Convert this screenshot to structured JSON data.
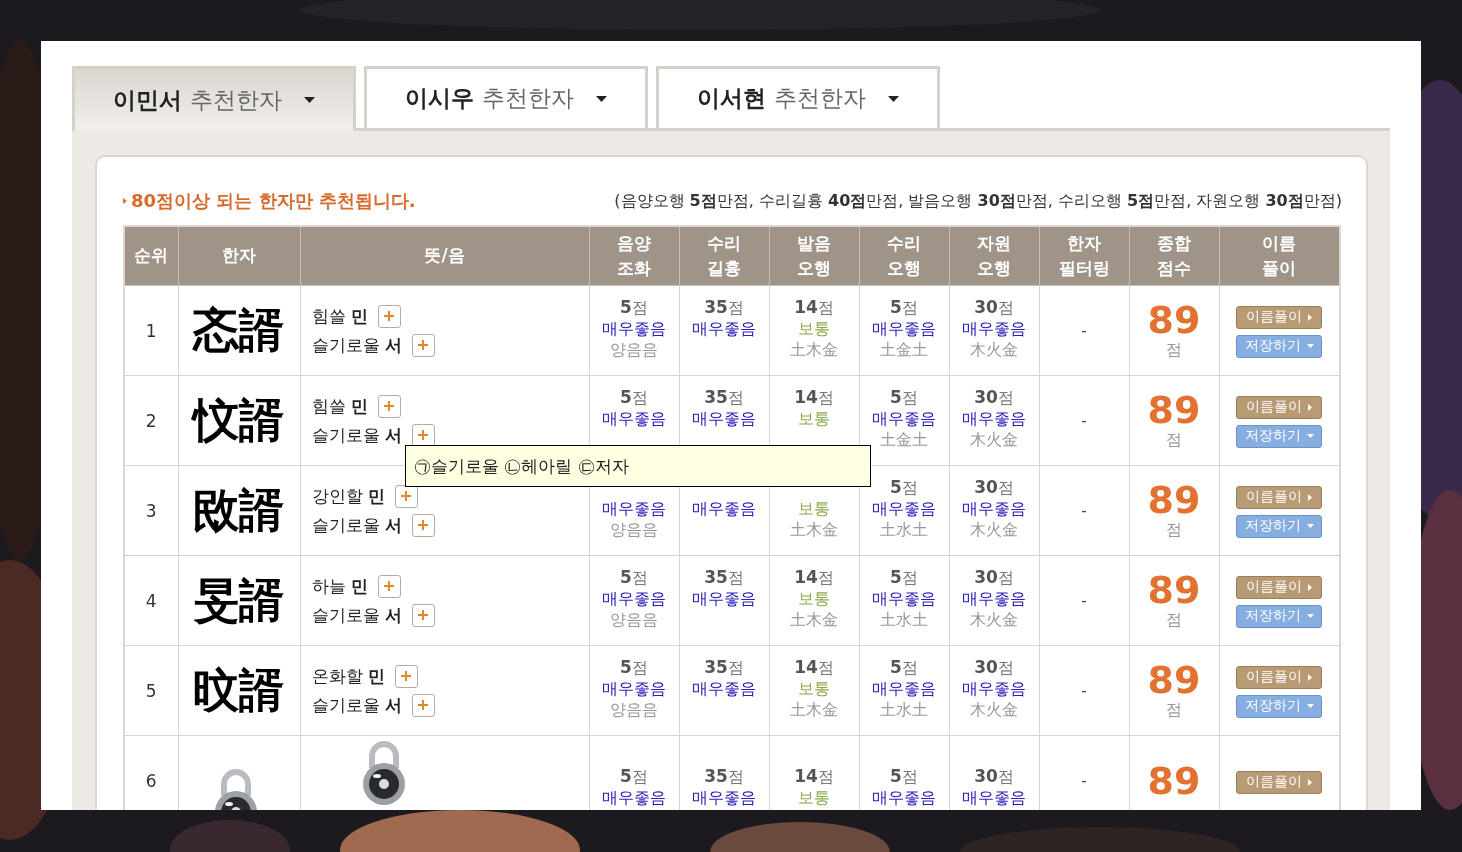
{
  "tabs": [
    {
      "label": "**이민서** 추천한자",
      "selected": true
    },
    {
      "label": "**이시우** 추천한자",
      "selected": false
    },
    {
      "label": "**이서현** 추천한자",
      "selected": false
    }
  ],
  "notice": "80점이상 되는 한자만 추천됩니다.",
  "legend": "(음양오행 **5점**만점, 수리길흉 **40점**만점, 발음오행 **30점**만점, 수리오행 **5점**만점, 자원오행 **30점**만점)",
  "table": {
    "columns": [
      "순위",
      "한자",
      "뜻/음",
      "음양\n조화",
      "수리\n길흉",
      "발음\n오행",
      "수리\n오행",
      "자원\n오행",
      "한자\n필터링",
      "종합\n점수",
      "이름\n풀이"
    ],
    "rows": [
      {
        "kind": "hanja",
        "rank": "1",
        "hanja": "忞諝",
        "meanings": [
          {
            "meaning": "힘쓸",
            "sound": "민"
          },
          {
            "meaning": "슬기로울",
            "sound": "서"
          }
        ],
        "scores": [
          {
            "score": "**5**점",
            "grade": "매우좋음",
            "color": "#2a20b8",
            "element": "양음음"
          },
          {
            "score": "**35**점",
            "grade": "매우좋음",
            "color": "#2a20b8"
          },
          {
            "score": "**14**점",
            "grade": "보통",
            "color": "#8bab50",
            "element": "土木金"
          },
          {
            "score": "**5**점",
            "grade": "매우좋음",
            "color": "#2a20b8",
            "element": "土金土"
          },
          {
            "score": "**30**점",
            "grade": "매우좋음",
            "color": "#2a20b8",
            "element": "木火金"
          }
        ],
        "filter": "-",
        "total": "89",
        "unit": "점",
        "buttons": [
          {
            "label": "이름풀이",
            "kind": "detail"
          },
          {
            "label": "저장하기",
            "kind": "save"
          }
        ]
      },
      {
        "kind": "hanja",
        "rank": "2",
        "hanja": "忟諝",
        "meanings": [
          {
            "meaning": "힘쓸",
            "sound": "민"
          },
          {
            "meaning": "슬기로울",
            "sound": "서"
          }
        ],
        "scores": [
          {
            "score": "**5**점",
            "grade": "매우좋음",
            "color": "#2a20b8"
          },
          {
            "score": "**35**점",
            "grade": "매우좋음",
            "color": "#2a20b8"
          },
          {
            "score": "**14**점",
            "grade": "보통",
            "color": "#8bab50"
          },
          {
            "score": "**5**점",
            "grade": "매우좋음",
            "color": "#2a20b8",
            "element": "土金土"
          },
          {
            "score": "**30**점",
            "grade": "매우좋음",
            "color": "#2a20b8",
            "element": "木火金"
          }
        ],
        "filter": "-",
        "total": "89",
        "unit": "점",
        "buttons": [
          {
            "label": "이름풀이",
            "kind": "detail"
          },
          {
            "label": "저장하기",
            "kind": "save"
          }
        ]
      },
      {
        "kind": "hanja",
        "rank": "3",
        "hanja": "敃諝",
        "meanings": [
          {
            "meaning": "강인할",
            "sound": "민"
          },
          {
            "meaning": "슬기로울",
            "sound": "서"
          }
        ],
        "scores": [
          {
            "grade": "매우좋음",
            "color": "#2a20b8",
            "element": "양음음"
          },
          {
            "grade": "매우좋음",
            "color": "#2a20b8"
          },
          {
            "grade": "보통",
            "color": "#8bab50",
            "element": "土木金"
          },
          {
            "score": "**5**점",
            "grade": "매우좋음",
            "color": "#2a20b8",
            "element": "土水土"
          },
          {
            "score": "**30**점",
            "grade": "매우좋음",
            "color": "#2a20b8",
            "element": "木火金"
          }
        ],
        "filter": "-",
        "total": "89",
        "unit": "점",
        "buttons": [
          {
            "label": "이름풀이",
            "kind": "detail"
          },
          {
            "label": "저장하기",
            "kind": "save"
          }
        ]
      },
      {
        "kind": "hanja",
        "rank": "4",
        "hanja": "旻諝",
        "meanings": [
          {
            "meaning": "하늘",
            "sound": "민"
          },
          {
            "meaning": "슬기로울",
            "sound": "서"
          }
        ],
        "scores": [
          {
            "score": "**5**점",
            "grade": "매우좋음",
            "color": "#2a20b8",
            "element": "양음음"
          },
          {
            "score": "**35**점",
            "grade": "매우좋음",
            "color": "#2a20b8"
          },
          {
            "score": "**14**점",
            "grade": "보통",
            "color": "#8bab50",
            "element": "土木金"
          },
          {
            "score": "**5**점",
            "grade": "매우좋음",
            "color": "#2a20b8",
            "element": "土水土"
          },
          {
            "score": "**30**점",
            "grade": "매우좋음",
            "color": "#2a20b8",
            "element": "木火金"
          }
        ],
        "filter": "-",
        "total": "89",
        "unit": "점",
        "buttons": [
          {
            "label": "이름풀이",
            "kind": "detail"
          },
          {
            "label": "저장하기",
            "kind": "save"
          }
        ]
      },
      {
        "kind": "hanja",
        "rank": "5",
        "hanja": "旼諝",
        "meanings": [
          {
            "meaning": "온화할",
            "sound": "민"
          },
          {
            "meaning": "슬기로울",
            "sound": "서"
          }
        ],
        "scores": [
          {
            "score": "**5**점",
            "grade": "매우좋음",
            "color": "#2a20b8",
            "element": "양음음"
          },
          {
            "score": "**35**점",
            "grade": "매우좋음",
            "color": "#2a20b8"
          },
          {
            "score": "**14**점",
            "grade": "보통",
            "color": "#8bab50",
            "element": "土木金"
          },
          {
            "score": "**5**점",
            "grade": "매우좋음",
            "color": "#2a20b8",
            "element": "土水土"
          },
          {
            "score": "**30**점",
            "grade": "매우좋음",
            "color": "#2a20b8",
            "element": "木火金"
          }
        ],
        "filter": "-",
        "total": "89",
        "unit": "점",
        "buttons": [
          {
            "label": "이름풀이",
            "kind": "detail"
          },
          {
            "label": "저장하기",
            "kind": "save"
          }
        ]
      },
      {
        "kind": "picture",
        "rank": "6",
        "scores": [
          {
            "score": "**5**점",
            "grade": "매우좋음",
            "color": "#2a20b8"
          },
          {
            "score": "**35**점",
            "grade": "매우좋음",
            "color": "#2a20b8"
          },
          {
            "score": "**14**점",
            "grade": "보통",
            "color": "#8bab50"
          },
          {
            "score": "**5**점",
            "grade": "매우좋음",
            "color": "#2a20b8"
          },
          {
            "score": "**30**점",
            "grade": "매우좋음",
            "color": "#2a20b8"
          }
        ],
        "filter": "-",
        "total": "89",
        "buttons": [
          {
            "label": "이름풀이",
            "kind": "detail"
          }
        ]
      }
    ]
  },
  "tooltip": {
    "text": "㉠슬기로울 ㉡헤아릴 ㉢저자"
  }
}
